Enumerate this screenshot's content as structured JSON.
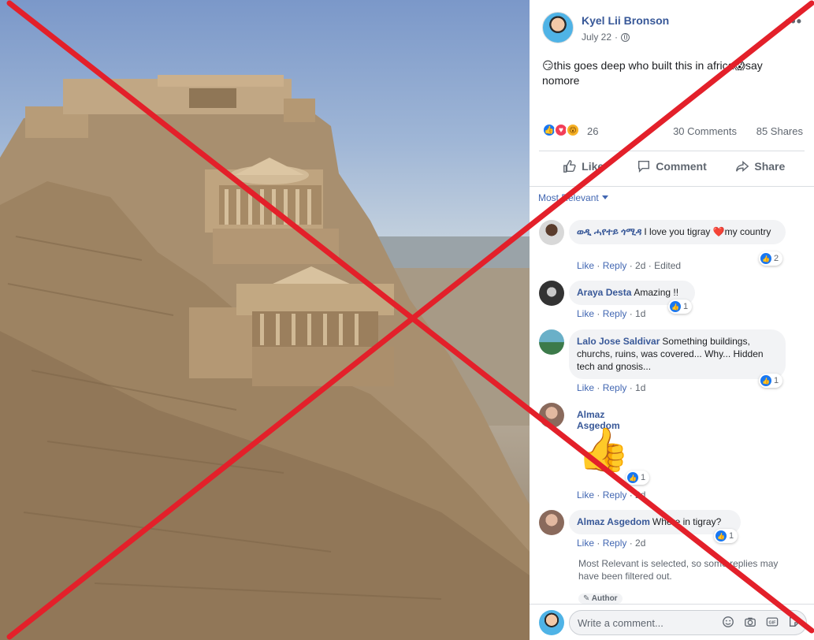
{
  "post": {
    "author": "Kyel Lii Bronson",
    "date": "July 22",
    "text": "😏this goes deep who built this in africa😱say nomore",
    "reaction_count": "26",
    "comments_count": "30 Comments",
    "shares_count": "85 Shares"
  },
  "actions": {
    "like": "Like",
    "comment": "Comment",
    "share": "Share"
  },
  "sort": {
    "label": "Most Relevant"
  },
  "comments": [
    {
      "name": "ወዲ ሓየተይ ጎሚዳ",
      "text": "I love you tigray ❤️my country",
      "like": "Like",
      "reply": "Reply",
      "time": "2d",
      "edited": "Edited",
      "likes": "2"
    },
    {
      "name": "Araya Desta",
      "text": "Amazing !!",
      "like": "Like",
      "reply": "Reply",
      "time": "1d",
      "likes": "1"
    },
    {
      "name": "Lalo Jose Saldivar",
      "text": "Something buildings, churchs, ruins, was covered... Why... Hidden tech and gnosis...",
      "like": "Like",
      "reply": "Reply",
      "time": "1d",
      "likes": "1"
    },
    {
      "name": "Almaz Asgedom",
      "sticker": "👍",
      "like": "Like",
      "reply": "Reply",
      "time": "2d",
      "likes": "1"
    },
    {
      "name": "Almaz Asgedom",
      "text": "Where in tigray?",
      "like": "Like",
      "reply": "Reply",
      "time": "2d",
      "likes": "1"
    }
  ],
  "filter_note": "Most Relevant is selected, so some replies may have been filtered out.",
  "author_tag": "Author",
  "composer": {
    "placeholder": "Write a comment..."
  },
  "colors": {
    "link_blue": "#385898",
    "fb_blue": "#1877f2",
    "overlay_red": "#e3202a"
  }
}
